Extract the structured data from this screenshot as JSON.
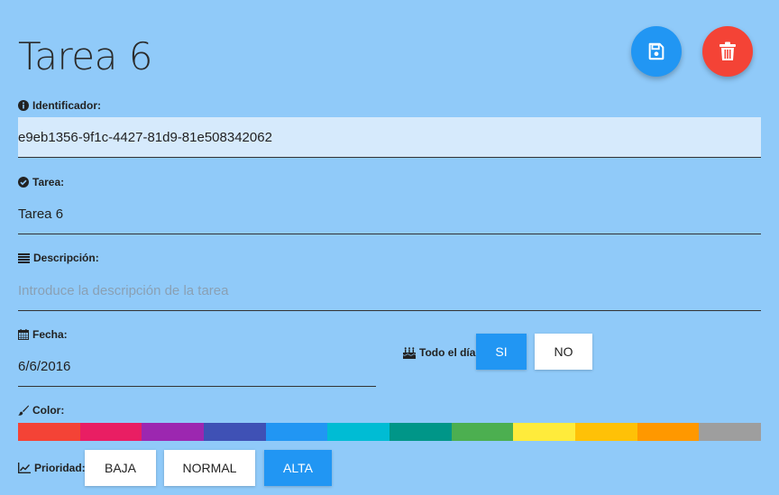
{
  "page": {
    "title": "Tarea 6"
  },
  "actions": {
    "save": "save-icon",
    "delete": "trash-icon"
  },
  "fields": {
    "id": {
      "label": "Identificador:",
      "value": "e9eb1356-9f1c-4427-81d9-81e508342062"
    },
    "task": {
      "label": "Tarea:",
      "value": "Tarea 6"
    },
    "description": {
      "label": "Descripción:",
      "value": "",
      "placeholder": "Introduce la descripción de la tarea"
    },
    "date": {
      "label": "Fecha:",
      "value": "6/6/2016"
    },
    "all_day": {
      "label": "Todo el día:",
      "yes": "SI",
      "no": "NO",
      "selected": "SI"
    },
    "color": {
      "label": "Color:"
    },
    "priority": {
      "label": "Prioridad:",
      "options": [
        "BAJA",
        "NORMAL",
        "ALTA"
      ],
      "selected": "ALTA"
    }
  },
  "colors": [
    "#f44336",
    "#e91e63",
    "#9c27b0",
    "#3f51b5",
    "#2196f3",
    "#00bcd4",
    "#009688",
    "#4caf50",
    "#ffeb3b",
    "#ffc107",
    "#ff9800",
    "#9e9e9e"
  ]
}
